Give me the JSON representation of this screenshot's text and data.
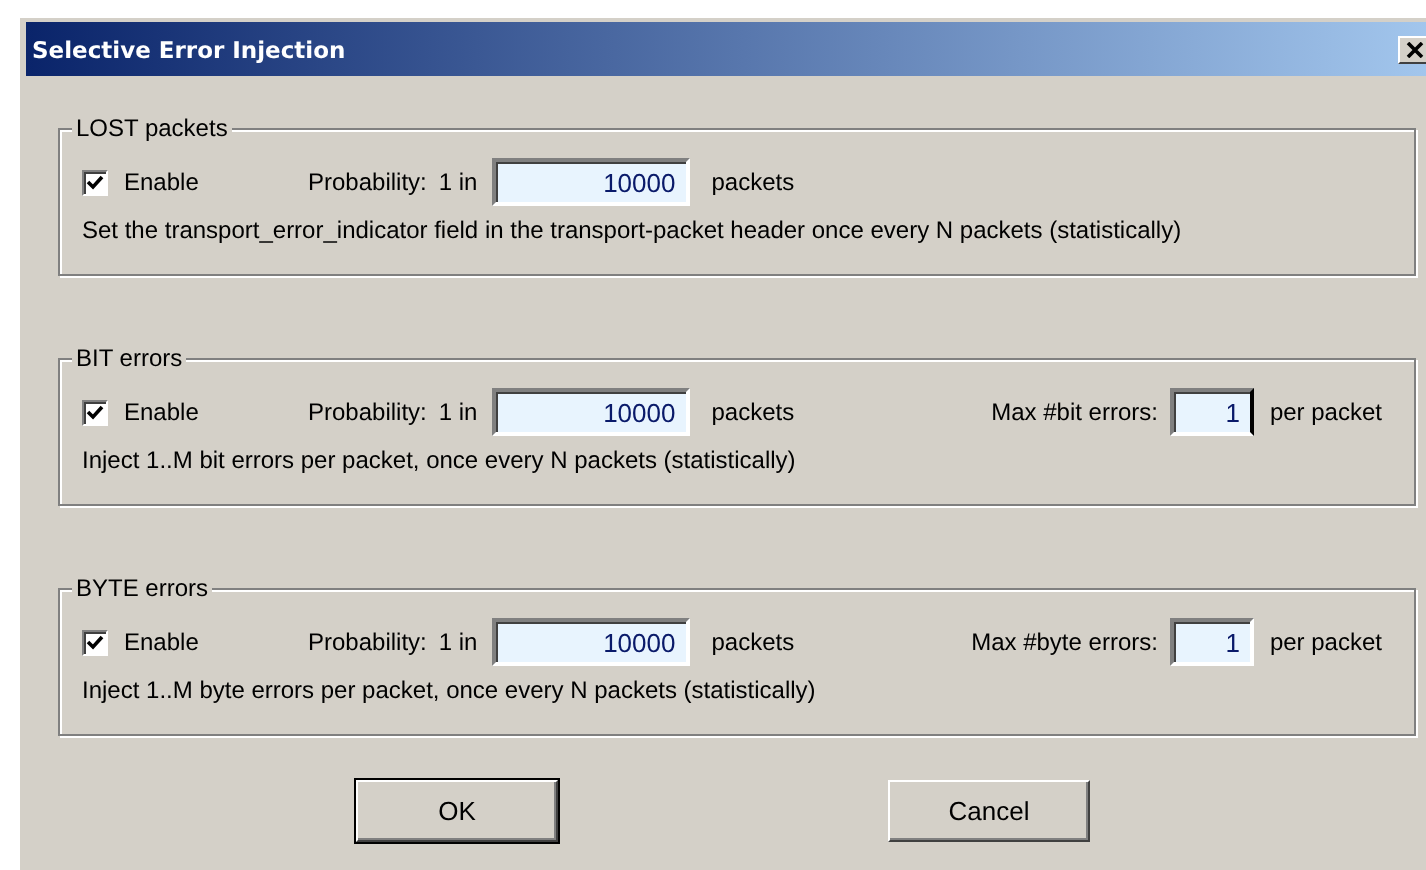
{
  "window": {
    "title": "Selective Error Injection"
  },
  "groups": [
    {
      "title": "LOST packets",
      "enable": {
        "label": "Enable",
        "checked": true
      },
      "probability_label": "Probability:",
      "one_in": "1 in",
      "probability_value": "10000",
      "probability_unit": "packets",
      "description": "Set the transport_error_indicator field in the transport-packet header once every N packets (statistically)"
    },
    {
      "title": "BIT errors",
      "enable": {
        "label": "Enable",
        "checked": true
      },
      "probability_label": "Probability:",
      "one_in": "1 in",
      "probability_value": "10000",
      "probability_unit": "packets",
      "max": {
        "label": "Max #bit errors:",
        "value": "1",
        "unit": "per packet",
        "focused": true
      },
      "description": "Inject 1..M bit errors per packet, once every N packets (statistically)"
    },
    {
      "title": "BYTE errors",
      "enable": {
        "label": "Enable",
        "checked": true
      },
      "probability_label": "Probability:",
      "one_in": "1 in",
      "probability_value": "10000",
      "probability_unit": "packets",
      "max": {
        "label": "Max #byte errors:",
        "value": "1",
        "unit": "per packet",
        "focused": false
      },
      "description": "Inject 1..M byte errors per packet, once every N packets (statistically)"
    }
  ],
  "buttons": [
    {
      "label": "OK",
      "default": true
    },
    {
      "label": "Cancel",
      "default": false
    }
  ]
}
